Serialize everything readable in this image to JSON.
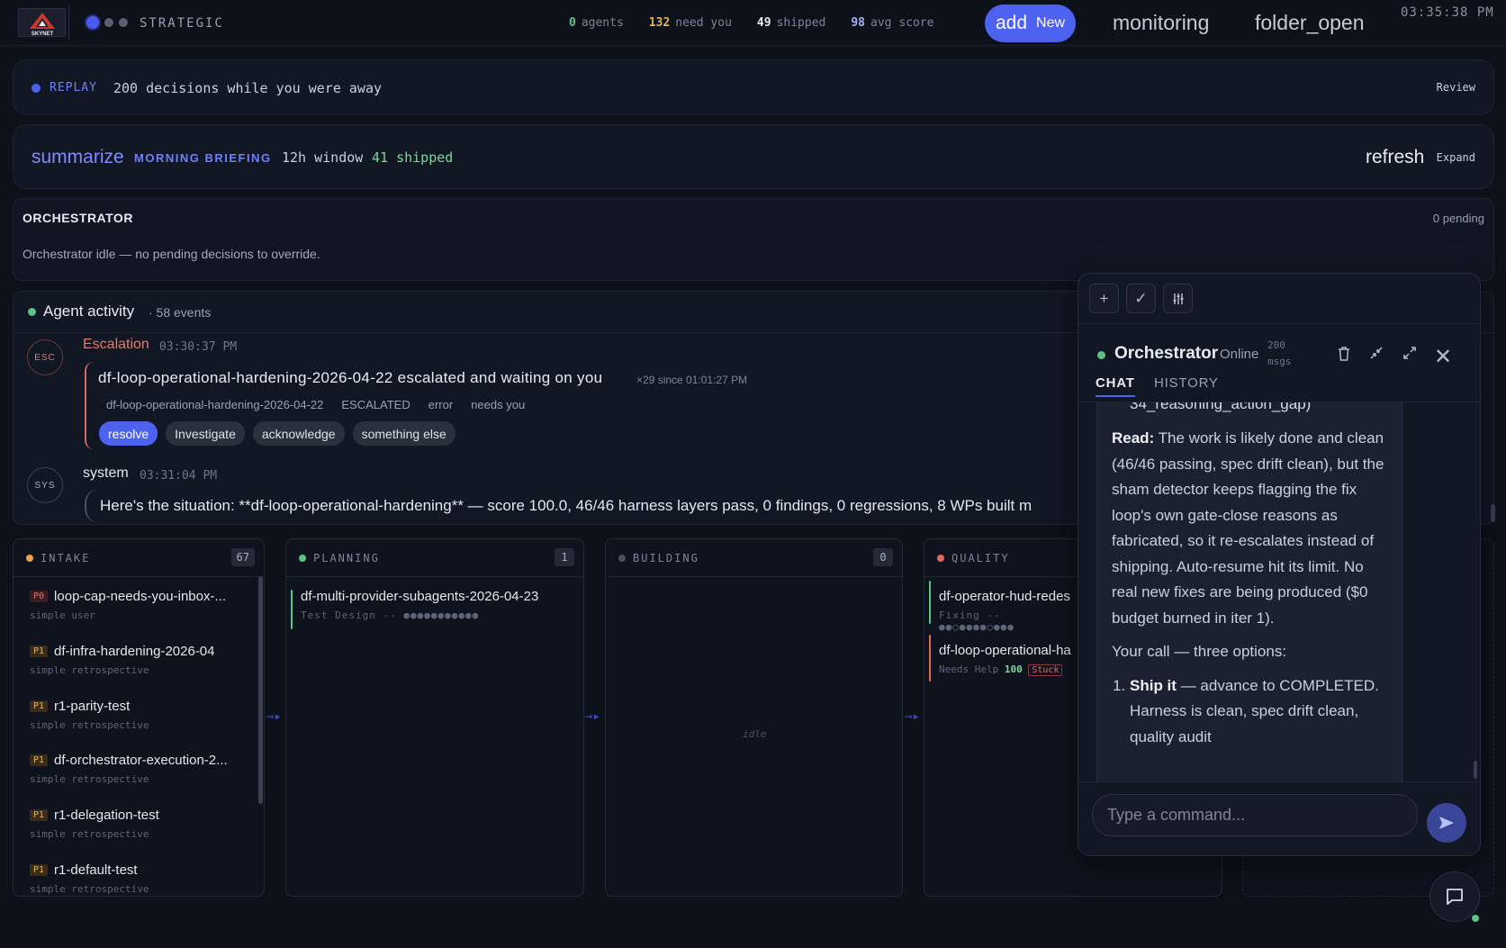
{
  "header": {
    "logo_text": "SKYNET",
    "mode": "STRATEGIC",
    "stats": [
      {
        "value": "0",
        "label": "agents"
      },
      {
        "value": "132",
        "label": "need you"
      },
      {
        "value": "49",
        "label": "shipped"
      },
      {
        "value": "98",
        "label": "avg score"
      }
    ],
    "add_icon": "add",
    "add_label": "New",
    "monitoring": "monitoring",
    "folder": "folder_open",
    "clock": "03:35:38 PM"
  },
  "replay": {
    "tag": "REPLAY",
    "message": "200 decisions while you were away",
    "action": "Review"
  },
  "briefing": {
    "icon": "summarize",
    "tag": "MORNING BRIEFING",
    "window": "12h window",
    "shipped": "41 shipped",
    "refresh": "refresh",
    "expand": "Expand"
  },
  "orchestrator": {
    "title": "ORCHESTRATOR",
    "pending": "0 pending",
    "idle": "Orchestrator idle — no pending decisions to override."
  },
  "activity": {
    "title": "Agent activity",
    "count": "· 58 events",
    "escalation": {
      "avatar": "ESC",
      "name": "Escalation",
      "time": "03:30:37 PM",
      "headline": "df-loop-operational-hardening-2026-04-22 escalated and waiting on you",
      "since": "×29 since 01:01:27 PM",
      "meta": [
        "df-loop-operational-hardening-2026-04-22",
        "ESCALATED",
        "error",
        "needs you"
      ],
      "actions": [
        "resolve",
        "Investigate",
        "acknowledge",
        "something else"
      ]
    },
    "system": {
      "avatar": "SYS",
      "name": "system",
      "time": "03:31:04 PM",
      "text": "Here's the situation: **df-loop-operational-hardening** — score 100.0, 46/46 harness layers pass, 0 findings, 0 regressions, 8 WPs built m"
    }
  },
  "pipeline": {
    "columns": [
      {
        "name": "INTAKE",
        "count": "67",
        "color": "#e5a54a"
      },
      {
        "name": "PLANNING",
        "count": "1",
        "color": "#5ec285"
      },
      {
        "name": "BUILDING",
        "count": "0",
        "color": "#4a5060"
      },
      {
        "name": "QUALITY",
        "count": "",
        "color": "#e06a5a"
      }
    ],
    "intake_items": [
      {
        "prio": "P0",
        "name": "loop-cap-needs-you-inbox-...",
        "sub": "simple user"
      },
      {
        "prio": "P1",
        "name": "df-infra-hardening-2026-04",
        "sub": "simple retrospective"
      },
      {
        "prio": "P1",
        "name": "r1-parity-test",
        "sub": "simple retrospective"
      },
      {
        "prio": "P1",
        "name": "df-orchestrator-execution-2...",
        "sub": "simple retrospective"
      },
      {
        "prio": "P1",
        "name": "r1-delegation-test",
        "sub": "simple retrospective"
      },
      {
        "prio": "P1",
        "name": "r1-default-test",
        "sub": "simple retrospective"
      }
    ],
    "planning_item": {
      "name": "df-multi-provider-subagents-2026-04-23",
      "sub": "Test Design -- ●●●●●●●●●●●"
    },
    "building_idle": "idle",
    "quality_items": [
      {
        "name": "df-operator-hud-redes",
        "sub": "Fixing -- ●●○●●●●○●●●"
      },
      {
        "name": "df-loop-operational-ha",
        "sub": "Needs Help",
        "score": "100",
        "badge": "Stuck"
      }
    ],
    "arrow": "→▸"
  },
  "chat": {
    "name": "Orchestrator",
    "status": "Online",
    "msgs": "200 msgs",
    "tabs": [
      "CHAT",
      "HISTORY"
    ],
    "clipped_line": "34_reasoning_action_gap)",
    "read_label": "Read:",
    "read_text": "The work is likely done and clean (46/46 passing, spec drift clean), but the sham detector keeps flagging the fix loop's own gate-close reasons as fabricated, so it re-escalates instead of shipping. Auto-resume hit its limit. No real new fixes are being produced ($0 budget burned in iter 1).",
    "call_text": "Your call — three options:",
    "option1_label": "Ship it",
    "option1_text": "— advance to COMPLETED. Harness is clean, spec drift clean, quality audit",
    "input_placeholder": "Type a command..."
  }
}
